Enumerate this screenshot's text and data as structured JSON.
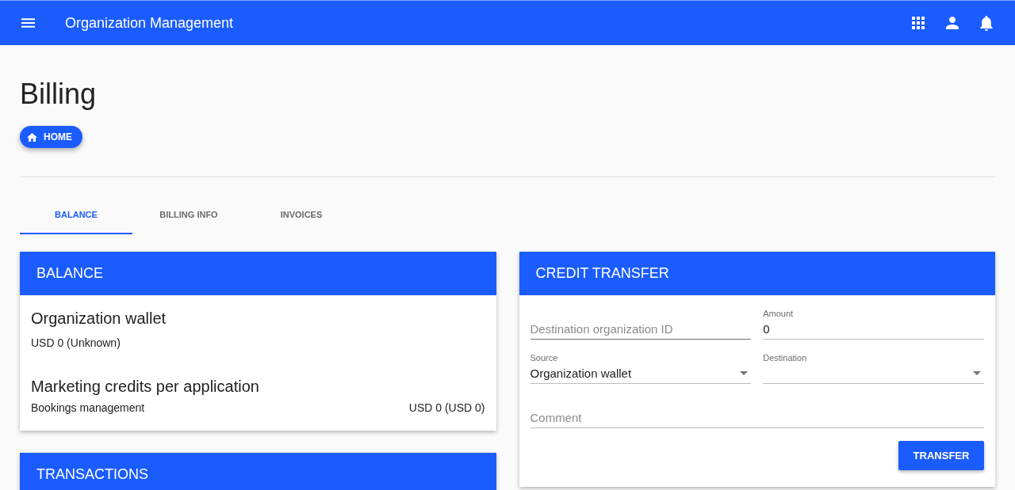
{
  "app_bar": {
    "title": "Organization Management"
  },
  "page": {
    "title": "Billing",
    "home_button": "HOME"
  },
  "tabs": [
    {
      "label": "BALANCE",
      "selected": true
    },
    {
      "label": "BILLING INFO",
      "selected": false
    },
    {
      "label": "INVOICES",
      "selected": false
    }
  ],
  "balance_card": {
    "title": "BALANCE",
    "wallet": {
      "heading": "Organization wallet",
      "value": "USD 0 (Unknown)"
    },
    "marketing": {
      "heading": "Marketing credits per application",
      "rows": [
        {
          "application": "Bookings management",
          "amount": "USD 0 (USD 0)"
        }
      ]
    }
  },
  "transactions_card": {
    "title": "TRANSACTIONS"
  },
  "credit_transfer": {
    "title": "CREDIT TRANSFER",
    "rows": [
      [
        {
          "kind": "text",
          "placeholder": "Destination organization ID",
          "hovered": true
        },
        {
          "kind": "text",
          "label": "Amount",
          "value": "0",
          "hovered": false
        }
      ],
      [
        {
          "kind": "select",
          "label": "Source",
          "value": "Organization wallet",
          "hovered": false
        },
        {
          "kind": "select",
          "label": "Destination",
          "hovered": false
        }
      ],
      [
        {
          "kind": "text",
          "placeholder": "Comment",
          "hovered": false
        }
      ]
    ],
    "button": "TRANSFER"
  }
}
